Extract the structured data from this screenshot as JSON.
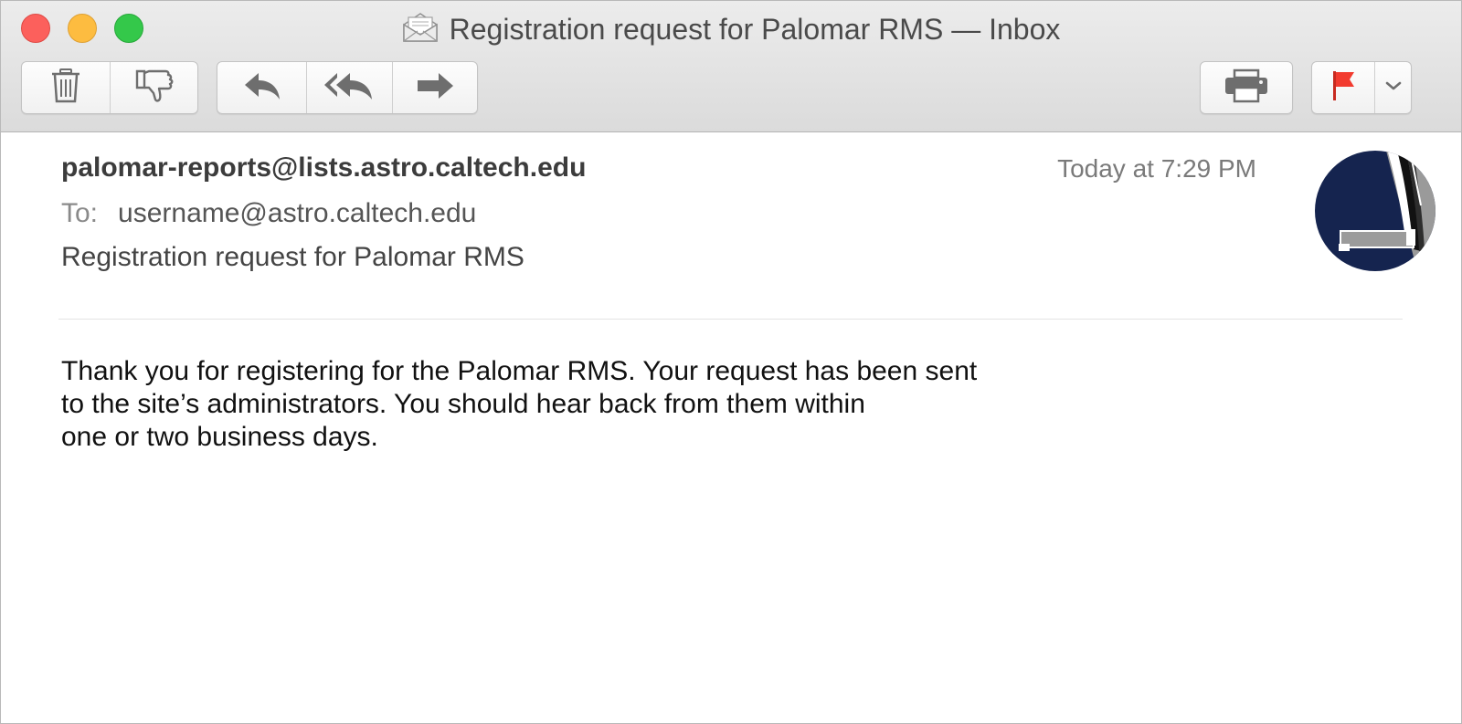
{
  "window": {
    "title": "Registration request for Palomar RMS — Inbox"
  },
  "toolbar": {
    "left_group": [
      {
        "name": "delete-button",
        "icon": "trash-icon"
      },
      {
        "name": "junk-button",
        "icon": "thumbs-down-icon"
      }
    ],
    "reply_group": [
      {
        "name": "reply-button",
        "icon": "reply-arrow-icon"
      },
      {
        "name": "reply-all-button",
        "icon": "reply-all-arrow-icon"
      },
      {
        "name": "forward-button",
        "icon": "forward-arrow-icon"
      }
    ],
    "right_items": [
      {
        "name": "print-button",
        "icon": "printer-icon"
      },
      {
        "name": "flag-button",
        "icon": "flag-icon"
      },
      {
        "name": "flag-menu-button",
        "icon": "chevron-down-icon"
      }
    ]
  },
  "message": {
    "from": "palomar-reports@lists.astro.caltech.edu",
    "date": "Today at 7:29 PM",
    "to_label": "To:",
    "to": "username@astro.caltech.edu",
    "subject": "Registration request for Palomar RMS",
    "body_lines": [
      "Thank you for registering for the Palomar RMS. Your request has been sent",
      "to the site’s administrators. You should hear back from them within",
      "one or two business days."
    ]
  },
  "colors": {
    "flag": "#f23b2f",
    "avatar_background": "#15244f",
    "close": "#fc605c",
    "minimize": "#fdbc40",
    "zoom": "#34c84a"
  }
}
